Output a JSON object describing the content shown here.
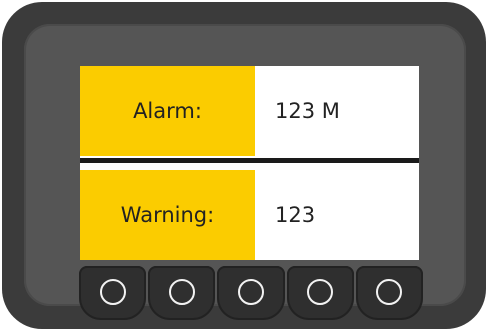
{
  "rows": [
    {
      "label": "Alarm:",
      "value": "123 M"
    },
    {
      "label": "Warning:",
      "value": "123"
    }
  ],
  "colors": {
    "highlight": "#fbcc00",
    "bezel": "#3b3b3b",
    "button_ring": "#f2f2f2"
  },
  "buttons": [
    "circle-icon",
    "circle-icon",
    "circle-icon",
    "circle-icon",
    "circle-icon"
  ]
}
